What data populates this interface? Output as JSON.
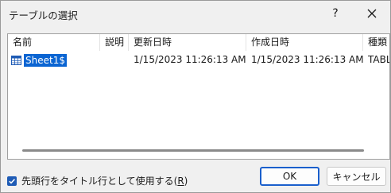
{
  "window": {
    "title": "テーブルの選択",
    "help_label": "?"
  },
  "table": {
    "columns": [
      "名前",
      "説明",
      "更新日時",
      "作成日時",
      "種類"
    ],
    "rows": [
      {
        "name": "Sheet1$",
        "description": "",
        "modified": "1/15/2023 11:26:13 AM",
        "created": "1/15/2023 11:26:13 AM",
        "type": "TABLE"
      }
    ]
  },
  "options": {
    "header_row_label_text": "先頭行をタイトル行として使用する(",
    "header_row_access_key": "R",
    "header_row_label_suffix": ")",
    "header_row_checked": true
  },
  "buttons": {
    "ok": "OK",
    "cancel": "キャンセル"
  },
  "colors": {
    "selection": "#0a64d2",
    "checkbox": "#1e5bb5",
    "primary_button_border": "#1a5fcc",
    "table_icon": "#1e5bb5"
  }
}
